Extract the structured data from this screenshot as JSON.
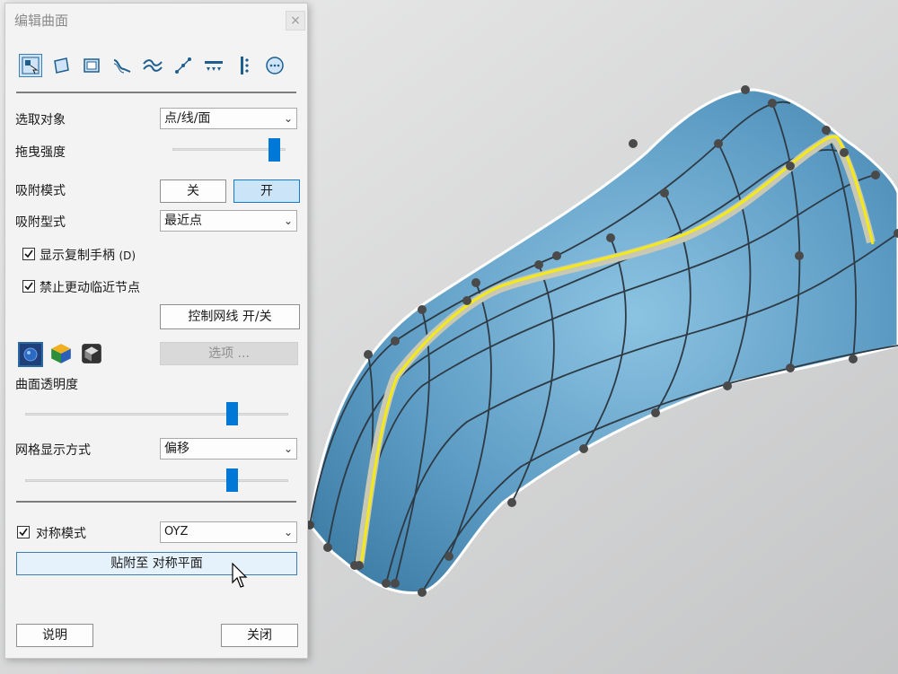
{
  "window": {
    "title": "编辑曲面",
    "close_glyph": "×"
  },
  "toolbar": {
    "tools": [
      {
        "icon": "select-region-icon",
        "active": true
      },
      {
        "icon": "edit-surface-icon",
        "active": false
      },
      {
        "icon": "frame-icon",
        "active": false
      },
      {
        "icon": "curve-edit-icon",
        "active": false
      },
      {
        "icon": "wave-icon",
        "active": false
      },
      {
        "icon": "line-points-icon",
        "active": false
      },
      {
        "icon": "points-row-icon",
        "active": false
      },
      {
        "icon": "column-points-icon",
        "active": false
      },
      {
        "icon": "more-icon",
        "active": false
      }
    ]
  },
  "select_object": {
    "label": "选取对象",
    "value": "点/线/面"
  },
  "drag_strength": {
    "label": "拖曳强度",
    "level": 0.95
  },
  "snap_mode": {
    "label": "吸附模式",
    "off": "关",
    "on": "开",
    "selected": "on"
  },
  "snap_type": {
    "label": "吸附型式",
    "value": "最近点"
  },
  "show_copy_handle": {
    "label": "显示复制手柄",
    "shortcut": "(D)",
    "checked": true
  },
  "lock_neighbor": {
    "label": "禁止更动临近节点",
    "checked": true
  },
  "control_mesh_button": "控制网线 开/关",
  "options_button": "选项 ...",
  "transparency": {
    "label": "曲面透明度",
    "level": 0.8
  },
  "mesh_display": {
    "label": "网格显示方式",
    "value": "偏移",
    "level": 0.8
  },
  "symmetry": {
    "label": "对称模式",
    "checked": true,
    "plane": "OYZ"
  },
  "snap_symmetry_button": "贴附至 对称平面",
  "footer": {
    "help": "说明",
    "close": "关闭"
  },
  "colors": {
    "accent": "#0078d7",
    "surface": "#6aa7cc",
    "highlight_curve": "#f3ea16"
  }
}
